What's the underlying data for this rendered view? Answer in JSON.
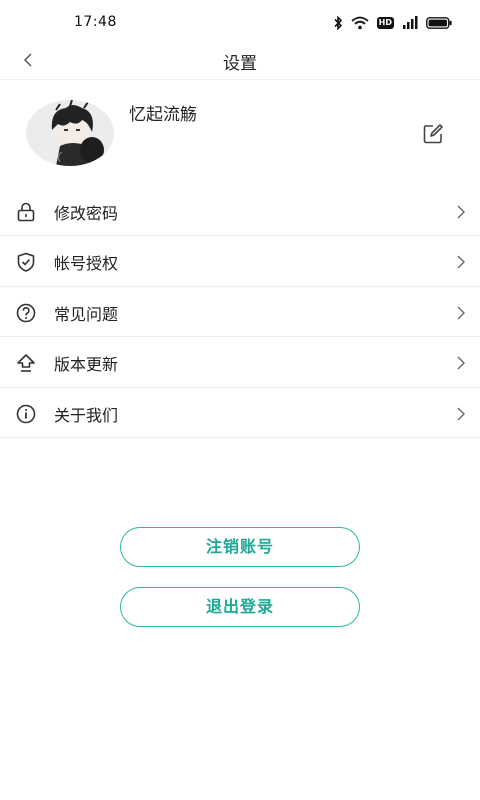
{
  "status_bar": {
    "time": "17:48",
    "icons": [
      "bluetooth-icon",
      "wifi-icon",
      "hd-icon",
      "signal-icon",
      "battery-icon"
    ],
    "hd_label": "HD"
  },
  "nav": {
    "title": "设置",
    "back_icon": "chevron-left-icon"
  },
  "profile": {
    "nickname": "忆起流觞",
    "edit_icon": "edit-icon"
  },
  "menu": [
    {
      "label": "修改密码",
      "icon": "lock-icon"
    },
    {
      "label": "帐号授权",
      "icon": "shield-check-icon"
    },
    {
      "label": "常见问题",
      "icon": "question-circle-icon"
    },
    {
      "label": "版本更新",
      "icon": "upload-arrow-icon"
    },
    {
      "label": "关于我们",
      "icon": "info-circle-icon"
    }
  ],
  "actions": {
    "cancel_account": "注销账号",
    "logout": "退出登录"
  },
  "colors": {
    "accent": "#1fa894",
    "accent_border": "#2db8a4",
    "text": "#222222",
    "divider": "#eeeeee"
  }
}
